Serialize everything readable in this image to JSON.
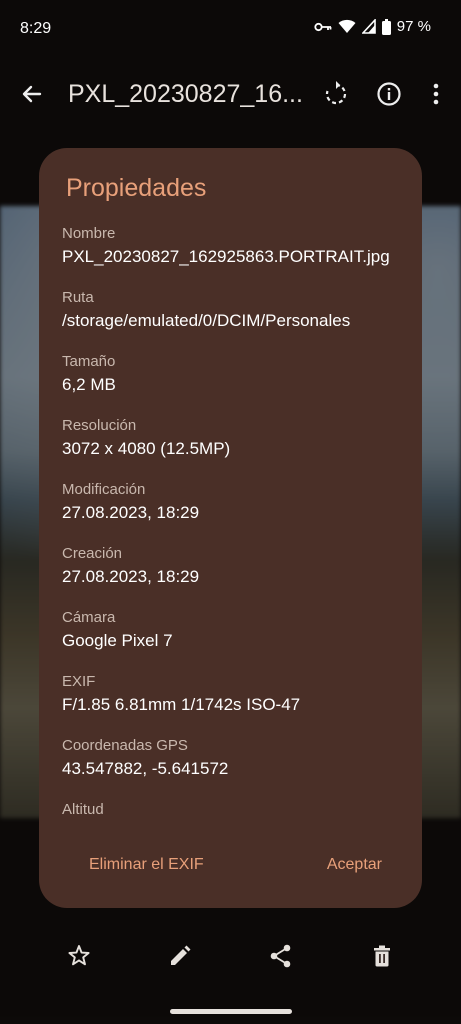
{
  "status_bar": {
    "time": "8:29",
    "battery": "97 %",
    "icons": [
      "key-icon",
      "wifi-icon",
      "signal-icon",
      "battery-icon"
    ]
  },
  "app_bar": {
    "title": "PXL_20230827_16...",
    "icons": [
      "back-arrow-icon",
      "rotate-icon",
      "info-icon",
      "more-vert-icon"
    ]
  },
  "dialog": {
    "title": "Propiedades",
    "properties": [
      {
        "label": "Nombre",
        "value": "PXL_20230827_162925863.PORTRAIT.jpg"
      },
      {
        "label": "Ruta",
        "value": "/storage/emulated/0/DCIM/Personales"
      },
      {
        "label": "Tamaño",
        "value": "6,2 MB"
      },
      {
        "label": "Resolución",
        "value": "3072 x 4080 (12.5MP)"
      },
      {
        "label": "Modificación",
        "value": "27.08.2023, 18:29"
      },
      {
        "label": "Creación",
        "value": "27.08.2023, 18:29"
      },
      {
        "label": "Cámara",
        "value": "Google Pixel 7"
      },
      {
        "label": "EXIF",
        "value": "F/1.85  6.81mm  1/1742s  ISO-47"
      },
      {
        "label": "Coordenadas GPS",
        "value": "43.547882, -5.641572"
      },
      {
        "label": "Altitud",
        "value": ""
      }
    ],
    "actions": {
      "remove_exif": "Eliminar el EXIF",
      "accept": "Aceptar"
    }
  },
  "bottom_bar": {
    "icons": [
      "star-icon",
      "edit-icon",
      "share-icon",
      "delete-icon"
    ]
  },
  "colors": {
    "dialog_bg": "#4a2f27",
    "accent": "#e8a07a",
    "label": "#c9b8ae"
  }
}
